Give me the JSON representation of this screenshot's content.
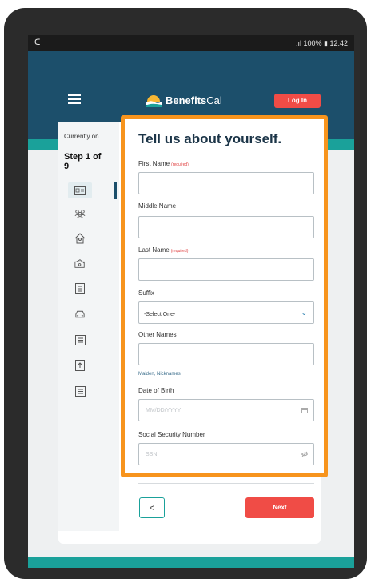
{
  "status_bar": {
    "left_icon": "c-notification-icon",
    "right_text": ".ıl 100% ▮ 12:42"
  },
  "header": {
    "logo_text_bold": "Benefits",
    "logo_text_rest": "Cal",
    "login_label": "Log In"
  },
  "sidebar": {
    "currently_label": "Currently on",
    "step_label": "Step 1 of 9",
    "icons": [
      "id-card-icon",
      "people-icon",
      "house-icon",
      "money-icon",
      "document-icon",
      "car-icon",
      "list-icon",
      "upload-document-icon",
      "list-icon-2"
    ]
  },
  "form": {
    "title": "Tell us about yourself.",
    "first_name_label": "First Name",
    "first_name_required": "(required)",
    "middle_name_label": "Middle Name",
    "last_name_label": "Last Name",
    "last_name_required": "(required)",
    "suffix_label": "Suffix",
    "suffix_value": "-Select One-",
    "other_names_label": "Other Names",
    "other_names_hint": "Maiden, Nicknames",
    "dob_label": "Date of Birth",
    "dob_placeholder": "MM/DD/YYYY",
    "ssn_label": "Social Security Number",
    "ssn_placeholder": "SSN"
  },
  "footer": {
    "back_label": "<",
    "next_label": "Next"
  },
  "colors": {
    "header": "#1c4f6b",
    "teal": "#1aa19a",
    "accent": "#f04c46",
    "highlight": "#f7941d"
  }
}
